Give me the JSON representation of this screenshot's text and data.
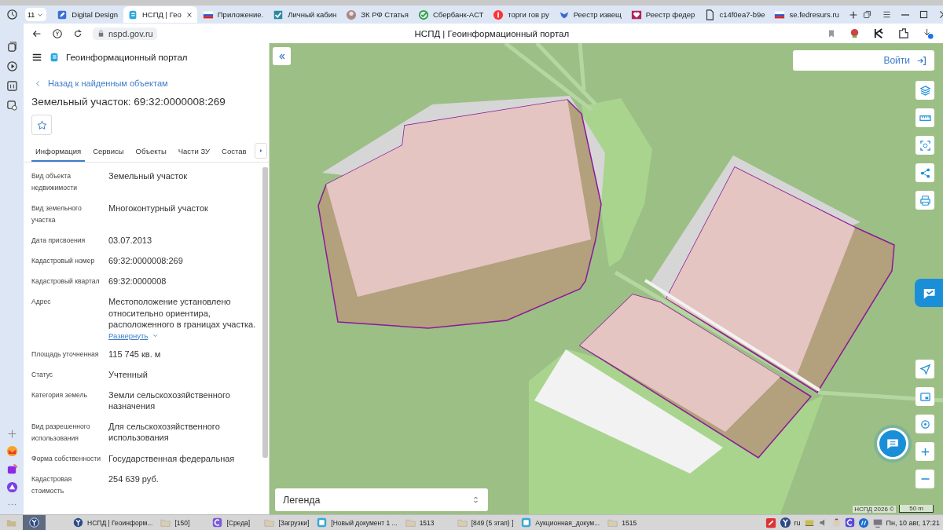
{
  "browser": {
    "tab_group": "11",
    "tabs": [
      {
        "title": "Digital Design",
        "selected": false,
        "kind": "pen"
      },
      {
        "title": "НСПД | Гео",
        "selected": true,
        "kind": "portal"
      },
      {
        "title": "Приложение.",
        "selected": false,
        "kind": "flag"
      },
      {
        "title": "Личный кабин",
        "selected": false,
        "kind": "check"
      },
      {
        "title": "ЗК РФ Статья",
        "selected": false,
        "kind": "avatar"
      },
      {
        "title": "Сбербанк-АСТ",
        "selected": false,
        "kind": "sber"
      },
      {
        "title": "торги гов ру",
        "selected": false,
        "kind": "ya"
      },
      {
        "title": "Реестр извещ",
        "selected": false,
        "kind": "eagle"
      },
      {
        "title": "Реестр федер",
        "selected": false,
        "kind": "heart"
      },
      {
        "title": "c14f0ea7-b9e",
        "selected": false,
        "kind": "file"
      },
      {
        "title": "se.fedresurs.ru",
        "selected": false,
        "kind": "flag"
      }
    ],
    "url": "nspd.gov.ru",
    "page_title": "НСПД | Геоинформационный портал"
  },
  "portal": {
    "title": "Геоинформационный портал",
    "back_link": "Назад к найденным объектам",
    "heading": "Земельный участок: 69:32:0000008:269",
    "tabs": [
      {
        "label": "Информация",
        "selected": true
      },
      {
        "label": "Сервисы",
        "selected": false
      },
      {
        "label": "Объекты",
        "selected": false
      },
      {
        "label": "Части ЗУ",
        "selected": false
      },
      {
        "label": "Состав",
        "selected": false
      }
    ],
    "fields": [
      {
        "label": "Вид объекта недвижимости",
        "value": "Земельный участок"
      },
      {
        "label": "Вид земельного участка",
        "value": "Многоконтурный участок"
      },
      {
        "label": "Дата присвоения",
        "value": "03.07.2013"
      },
      {
        "label": "Кадастровый номер",
        "value": "69:32:0000008:269"
      },
      {
        "label": "Кадастровый квартал",
        "value": "69:32:0000008"
      },
      {
        "label": "Адрес",
        "value": "Местоположение установлено относительно ориентира, расположенного в границах участка.",
        "expand_link": "Развернуть"
      },
      {
        "label": "Площадь уточненная",
        "value": "115 745 кв. м"
      },
      {
        "label": "Статус",
        "value": "Учтенный"
      },
      {
        "label": "Категория земель",
        "value": "Земли сельскохозяйственного назначения"
      },
      {
        "label": "Вид разрешенного использования",
        "value": "Для сельскохозяйственного использования"
      },
      {
        "label": "Форма собственности",
        "value": "Государственная федеральная"
      },
      {
        "label": "Кадастровая стоимость",
        "value": "254 639 руб."
      }
    ]
  },
  "map": {
    "login_button": "Войти",
    "legend": "Легенда",
    "attribution": "НСПД 2026 ©",
    "scale": "50 m"
  },
  "taskbar": {
    "items": [
      {
        "label": "НСПД | Геоинформ...",
        "kind": "browser"
      },
      {
        "label": "[150]",
        "kind": "folder"
      },
      {
        "label": "[Среда]",
        "kind": "editor"
      },
      {
        "label": "[Загрузки]",
        "kind": "folder"
      },
      {
        "label": "[Новый документ 1 ...",
        "kind": "doc"
      },
      {
        "label": "1513",
        "kind": "folder"
      },
      {
        "label": "[849 (5 этап) ]",
        "kind": "folder"
      },
      {
        "label": "Аукционная_докум...",
        "kind": "doc"
      },
      {
        "label": "1515",
        "kind": "folder"
      }
    ],
    "language": "ru",
    "clock": "Пн, 10 авг, 17:21"
  }
}
